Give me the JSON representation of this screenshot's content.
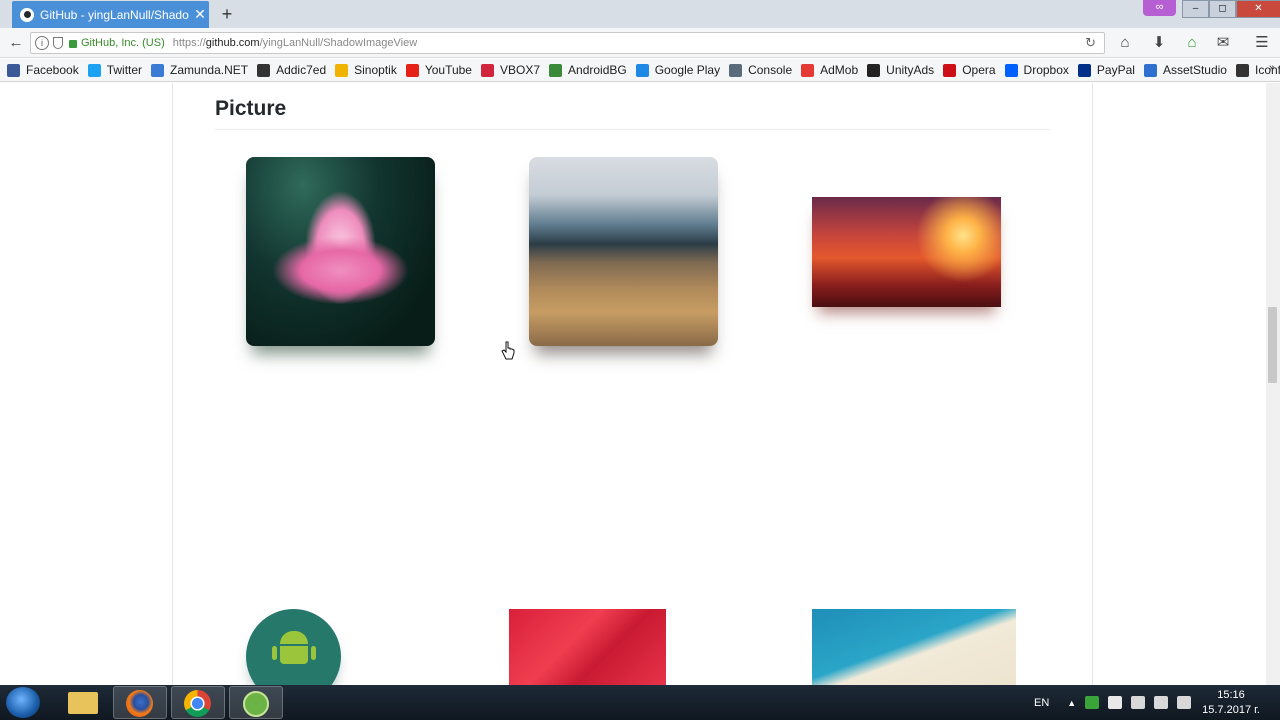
{
  "browser": {
    "tab_title": "GitHub - yingLanNull/Shado",
    "tab_close": "✕",
    "new_tab": "+",
    "window_controls": [
      "–",
      "◻",
      "✕"
    ]
  },
  "navbar": {
    "org": "GitHub, Inc. (US)",
    "url_scheme": "https://",
    "url_host": "github.com",
    "url_path": "/yingLanNull/ShadowImageView"
  },
  "bookmarks": [
    {
      "label": "Facebook",
      "color": "#3b5998"
    },
    {
      "label": "Twitter",
      "color": "#1da1f2"
    },
    {
      "label": "Zamunda.NET",
      "color": "#3a7bd5"
    },
    {
      "label": "Addic7ed",
      "color": "#333333"
    },
    {
      "label": "Sinoptik",
      "color": "#f0b400"
    },
    {
      "label": "YouTube",
      "color": "#e62117"
    },
    {
      "label": "VBOX7",
      "color": "#d0253c"
    },
    {
      "label": "AndroidBG",
      "color": "#3a8a3a"
    },
    {
      "label": "Google Play",
      "color": "#1e88e5"
    },
    {
      "label": "Console",
      "color": "#5a6b7c"
    },
    {
      "label": "AdMob",
      "color": "#e53935"
    },
    {
      "label": "UnityAds",
      "color": "#222222"
    },
    {
      "label": "Opera",
      "color": "#cc0f16"
    },
    {
      "label": "Dropbox",
      "color": "#0061ff"
    },
    {
      "label": "PayPal",
      "color": "#003087"
    },
    {
      "label": "AssetStudio",
      "color": "#2f6fd0"
    },
    {
      "label": "Iconfinder",
      "color": "#333333"
    }
  ],
  "page": {
    "heading": "Picture"
  },
  "taskbar": {
    "language": "EN",
    "time": "15:16",
    "date": "15.7.2017 г."
  }
}
